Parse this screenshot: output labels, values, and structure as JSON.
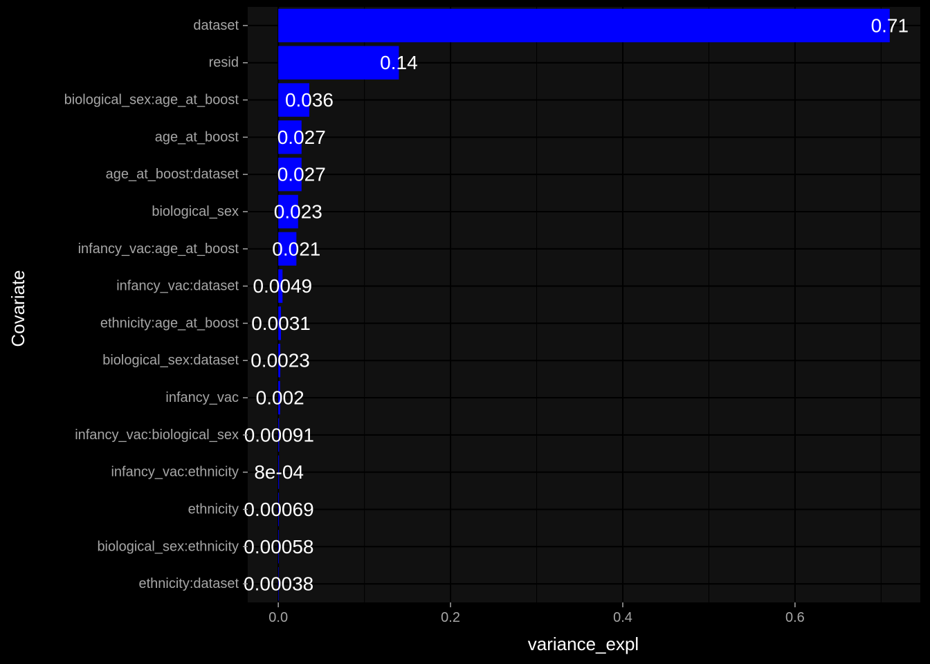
{
  "chart_data": {
    "type": "bar",
    "orientation": "horizontal",
    "categories": [
      "dataset",
      "resid",
      "biological_sex:age_at_boost",
      "age_at_boost",
      "age_at_boost:dataset",
      "biological_sex",
      "infancy_vac:age_at_boost",
      "infancy_vac:dataset",
      "ethnicity:age_at_boost",
      "biological_sex:dataset",
      "infancy_vac",
      "infancy_vac:biological_sex",
      "infancy_vac:ethnicity",
      "ethnicity",
      "biological_sex:ethnicity",
      "ethnicity:dataset"
    ],
    "values": [
      0.71,
      0.14,
      0.036,
      0.027,
      0.027,
      0.023,
      0.021,
      0.0049,
      0.0031,
      0.0023,
      0.002,
      0.00091,
      0.0008,
      0.00069,
      0.00058,
      0.00038
    ],
    "value_labels": [
      "0.71",
      "0.14",
      "0.036",
      "0.027",
      "0.027",
      "0.023",
      "0.021",
      "0.0049",
      "0.0031",
      "0.0023",
      "0.002",
      "0.00091",
      "8e-04",
      "0.00069",
      "0.00058",
      "0.00038"
    ],
    "xlabel": "variance_expl",
    "ylabel": "Covariate",
    "xlim": [
      -0.0355,
      0.7455
    ],
    "xticks": [
      0.0,
      0.2,
      0.4,
      0.6
    ],
    "xtick_labels": [
      "0.0",
      "0.2",
      "0.4",
      "0.6"
    ],
    "grid": true,
    "colors": {
      "bar": "#0000ff",
      "background": "#000000",
      "panel": "#111111",
      "grid": "#000000",
      "tick_text": "#a6a6a6",
      "text": "#ffffff"
    }
  }
}
